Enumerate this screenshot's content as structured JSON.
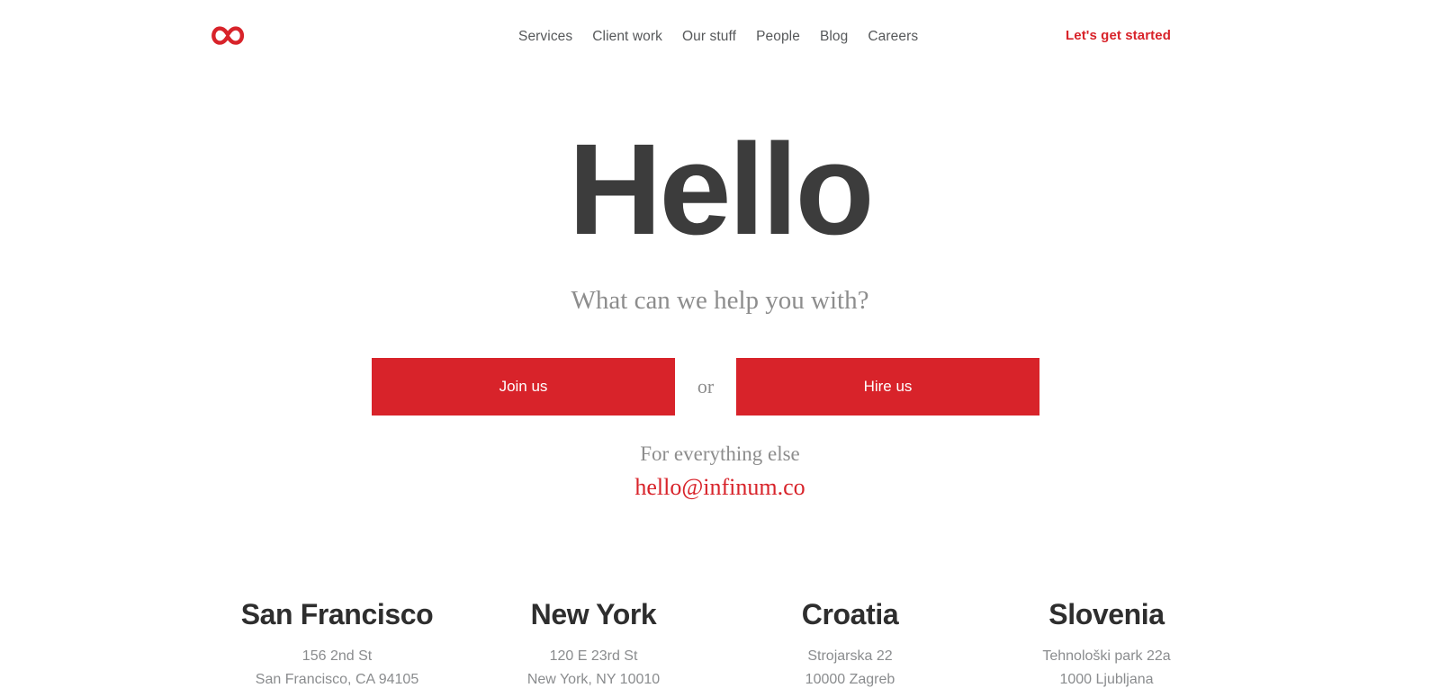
{
  "header": {
    "logo_icon": "infinity-logo-icon",
    "logo_color": "#d8232a",
    "nav": [
      {
        "label": "Services"
      },
      {
        "label": "Client work"
      },
      {
        "label": "Our stuff"
      },
      {
        "label": "People"
      },
      {
        "label": "Blog"
      },
      {
        "label": "Careers"
      }
    ],
    "cta_label": "Let's get started",
    "cta_color": "#d8232a"
  },
  "hero": {
    "title": "Hello",
    "title_color": "#3c3c3c",
    "subtitle": "What can we help you with?",
    "subtitle_color": "#8d8d8d"
  },
  "cta": {
    "join_label": "Join us",
    "separator": "or",
    "hire_label": "Hire us",
    "button_color": "#d8232a",
    "button_text_color": "#ffffff"
  },
  "contact": {
    "everything_else": "For everything else",
    "email": "hello@infinum.co",
    "email_color": "#d8232a"
  },
  "offices": [
    {
      "city": "San Francisco",
      "address_line1": "156 2nd St",
      "address_line2": "San Francisco, CA 94105"
    },
    {
      "city": "New York",
      "address_line1": "120 E 23rd St",
      "address_line2": "New York, NY 10010"
    },
    {
      "city": "Croatia",
      "address_line1": "Strojarska 22",
      "address_line2": "10000 Zagreb"
    },
    {
      "city": "Slovenia",
      "address_line1": "Tehnološki park 22a",
      "address_line2": "1000 Ljubljana"
    }
  ]
}
